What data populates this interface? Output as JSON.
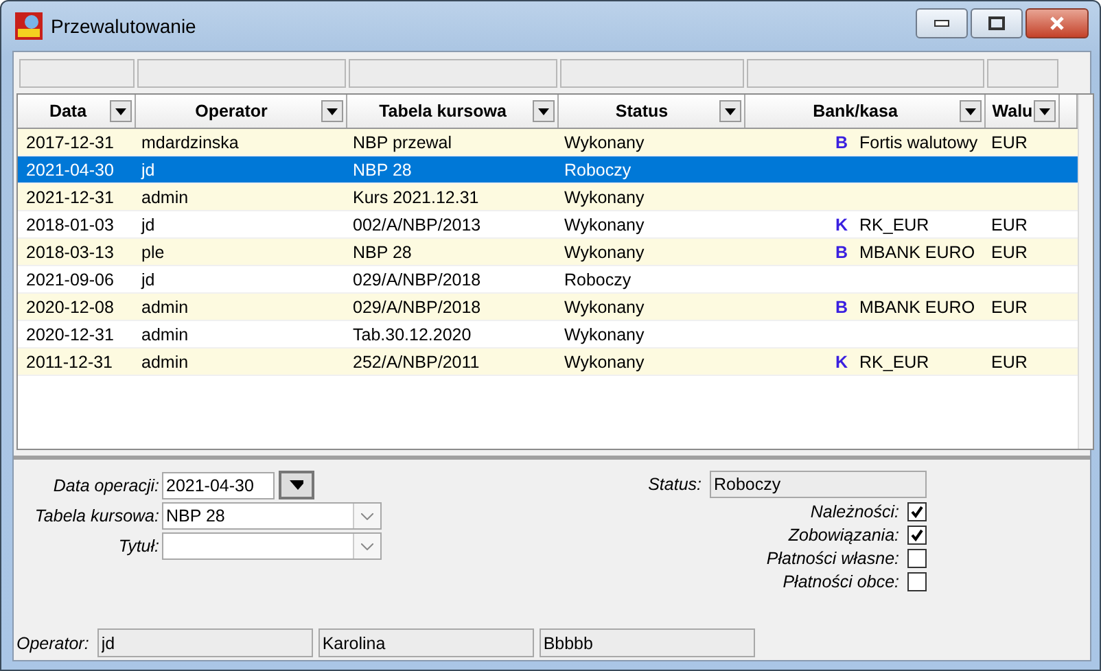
{
  "window": {
    "title": "Przewalutowanie"
  },
  "table": {
    "columns": [
      {
        "label": "Data"
      },
      {
        "label": "Operator"
      },
      {
        "label": "Tabela kursowa"
      },
      {
        "label": "Status"
      },
      {
        "label": "Bank/kasa"
      },
      {
        "label": "Walu"
      }
    ],
    "rows": [
      {
        "date": "2017-12-31",
        "operator": "mdardzinska",
        "table": "NBP przewal",
        "status": "Wykonany",
        "bank_type": "B",
        "bank": "Fortis walutowy",
        "currency": "EUR",
        "selected": false
      },
      {
        "date": "2021-04-30",
        "operator": "jd",
        "table": "NBP 28",
        "status": "Roboczy",
        "selected": true
      },
      {
        "date": "2021-12-31",
        "operator": "admin",
        "table": "Kurs 2021.12.31",
        "status": "Wykonany",
        "selected": false
      },
      {
        "date": "2018-01-03",
        "operator": "jd",
        "table": "002/A/NBP/2013",
        "status": "Wykonany",
        "bank_type": "K",
        "bank": "RK_EUR",
        "currency": "EUR",
        "selected": false
      },
      {
        "date": "2018-03-13",
        "operator": "ple",
        "table": "NBP 28",
        "status": "Wykonany",
        "bank_type": "B",
        "bank": "MBANK EURO",
        "currency": "EUR",
        "selected": false
      },
      {
        "date": "2021-09-06",
        "operator": "jd",
        "table": "029/A/NBP/2018",
        "status": "Roboczy",
        "selected": false
      },
      {
        "date": "2020-12-08",
        "operator": "admin",
        "table": "029/A/NBP/2018",
        "status": "Wykonany",
        "bank_type": "B",
        "bank": "MBANK EURO",
        "currency": "EUR",
        "selected": false
      },
      {
        "date": "2020-12-31",
        "operator": "admin",
        "table": "Tab.30.12.2020",
        "status": "Wykonany",
        "selected": false
      },
      {
        "date": "2011-12-31",
        "operator": "admin",
        "table": "252/A/NBP/2011",
        "status": "Wykonany",
        "bank_type": "K",
        "bank": "RK_EUR",
        "currency": "EUR",
        "selected": false
      }
    ]
  },
  "details": {
    "date": {
      "label": "Data operacji:",
      "value": "2021-04-30"
    },
    "rate_table": {
      "label": "Tabela kursowa:",
      "value": "NBP 28"
    },
    "title": {
      "label": "Tytuł:"
    },
    "status": {
      "label": "Status:",
      "value": "Roboczy"
    },
    "checks": [
      {
        "label": "Należności:",
        "checked": true
      },
      {
        "label": "Zobowiązania:",
        "checked": true
      },
      {
        "label": "Płatności własne:",
        "checked": false
      },
      {
        "label": "Płatności obce:",
        "checked": false
      }
    ]
  },
  "footer": {
    "label": "Operator:",
    "values": [
      "jd",
      "Karolina",
      "Bbbbb"
    ]
  }
}
